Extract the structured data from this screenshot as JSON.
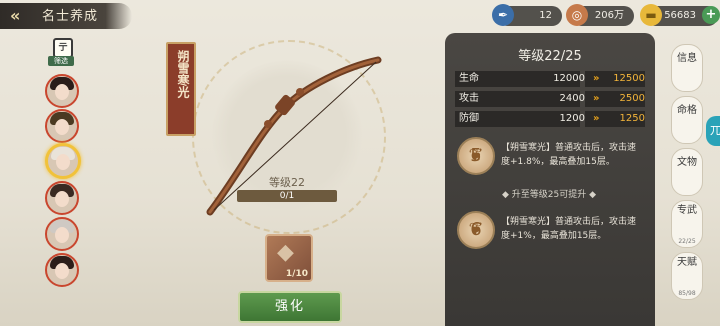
{
  "header": {
    "back_icon": "«",
    "title": "名士养成"
  },
  "resources": [
    {
      "icon": "✒",
      "value": "12",
      "color": "#3b6ea8"
    },
    {
      "icon": "◎",
      "value": "206万",
      "color": "#c67a4a"
    },
    {
      "icon": "▬",
      "value": "56683",
      "color": "#e8b83a"
    }
  ],
  "plus_label": "+",
  "filter": {
    "icon": "亍",
    "label": "筛选"
  },
  "equipment": {
    "name": "朔雪寒光",
    "level_label": "等级22",
    "xp_text": "0/1",
    "xp_progress": 0,
    "material_icon": "◆",
    "material_count": "1/10",
    "upgrade_label": "强化"
  },
  "stats_panel": {
    "title": "等级22/25",
    "stats": [
      {
        "name": "生命",
        "current": "12000",
        "arrow": "»",
        "next": "12500"
      },
      {
        "name": "攻击",
        "current": "2400",
        "arrow": "»",
        "next": "2500"
      },
      {
        "name": "防御",
        "current": "1200",
        "arrow": "»",
        "next": "1250"
      }
    ],
    "skills": [
      {
        "level": "5",
        "text": "【朔雪寒光】普通攻击后，攻击速度+1.8%，最高叠加15层。"
      },
      {
        "level": "6",
        "text": "【朔雪寒光】普通攻击后，攻击速度+1%，最高叠加15层。"
      }
    ],
    "separator": "◆ 升至等级25可提升 ◆"
  },
  "tabs": [
    {
      "label": "信息",
      "sub": ""
    },
    {
      "label": "命格",
      "sub": ""
    },
    {
      "label": "文物",
      "sub": ""
    },
    {
      "label": "专武",
      "sub": "22/25"
    },
    {
      "label": "天赋",
      "sub": "85/98"
    }
  ],
  "edge_label": "兀",
  "colors": {
    "accent_orange": "#f2b43a",
    "panel": "#3f3c39",
    "upgrade_green": "#4c8840",
    "name_plate": "#8b3d2a"
  }
}
